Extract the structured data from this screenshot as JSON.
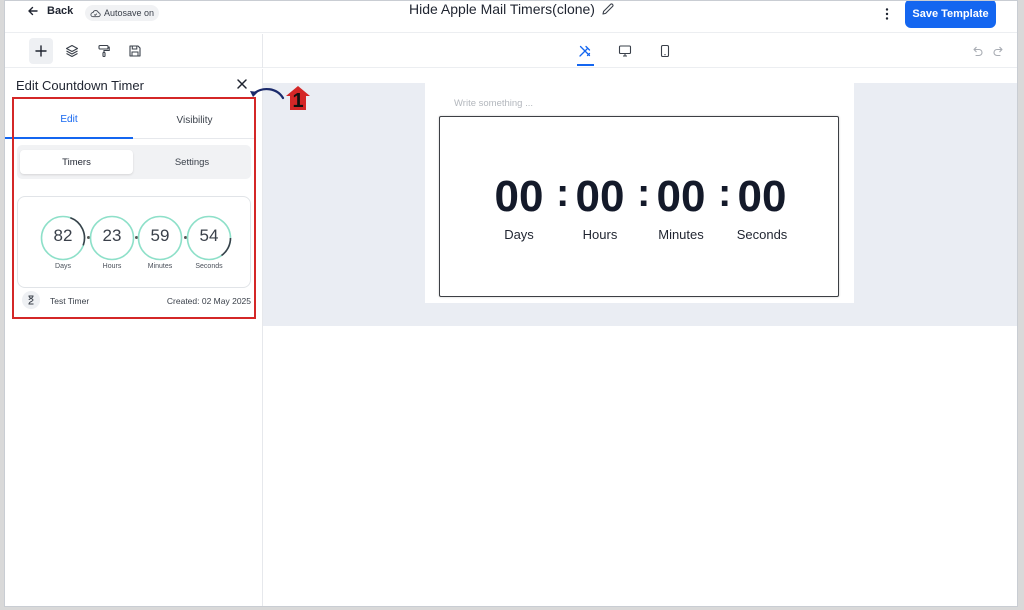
{
  "topbar": {
    "back_label": "Back",
    "autosave_label": "Autosave on",
    "document_title": "Hide Apple Mail Timers(clone)",
    "save_template_label": "Save Template"
  },
  "toolbar": {
    "tools": [
      "add-icon",
      "layers-icon",
      "paint-roller-icon",
      "save-icon"
    ],
    "devices": [
      "design-tools-icon",
      "desktop-icon",
      "mobile-icon"
    ],
    "history": [
      "undo-icon",
      "redo-icon"
    ]
  },
  "panel": {
    "title": "Edit Countdown Timer",
    "tabs": [
      {
        "label": "Edit",
        "active": true
      },
      {
        "label": "Visibility",
        "active": false
      }
    ],
    "segments": [
      {
        "label": "Timers",
        "active": true
      },
      {
        "label": "Settings",
        "active": false
      }
    ],
    "timer_preview": {
      "units": [
        {
          "value": "82",
          "label": "Days"
        },
        {
          "value": "23",
          "label": "Hours"
        },
        {
          "value": "59",
          "label": "Minutes"
        },
        {
          "value": "54",
          "label": "Seconds"
        }
      ]
    },
    "timer_name": "Test Timer",
    "timer_created": "Created: 02 May 2025"
  },
  "annotation": {
    "number": "1",
    "color": "#d42727"
  },
  "canvas": {
    "placeholder": "Write something ...",
    "countdown": {
      "units": [
        {
          "value": "00",
          "label": "Days"
        },
        {
          "value": "00",
          "label": "Hours"
        },
        {
          "value": "00",
          "label": "Minutes"
        },
        {
          "value": "00",
          "label": "Seconds"
        }
      ]
    }
  },
  "colors": {
    "accent": "#1466f0",
    "ring": "#8ee0c9",
    "highlight": "#d42727",
    "canvas_bg": "#eaedf3"
  }
}
